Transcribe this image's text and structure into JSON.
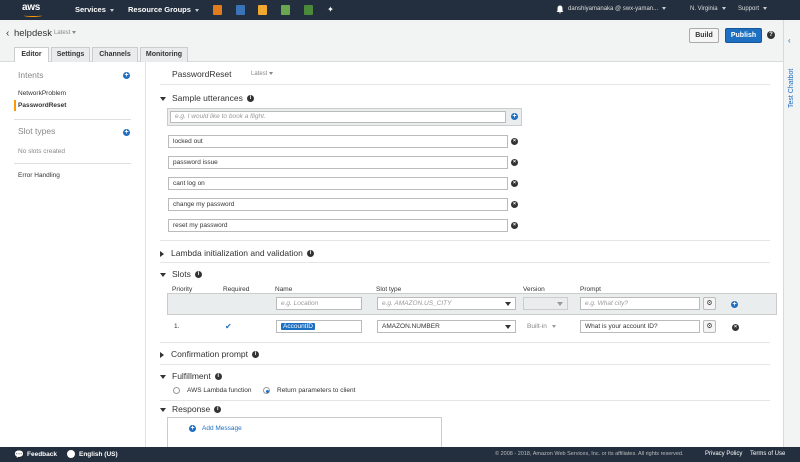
{
  "topnav": {
    "logo": "aws",
    "services": "Services",
    "resource_groups": "Resource Groups",
    "user": "danshiyamanaka @ swx-yaman...",
    "region": "N. Virginia",
    "support": "Support"
  },
  "header": {
    "app_name": "helpdesk",
    "app_version": "Latest",
    "tabs": [
      {
        "label": "Editor"
      },
      {
        "label": "Settings"
      },
      {
        "label": "Channels"
      },
      {
        "label": "Monitoring"
      }
    ],
    "build_label": "Build",
    "publish_label": "Publish",
    "help": "?"
  },
  "chatbot": {
    "label": "Test Chatbot",
    "chevron": "‹"
  },
  "sidebar": {
    "intents_heading": "Intents",
    "intents": [
      {
        "label": "NetworkProblem"
      },
      {
        "label": "PasswordReset"
      }
    ],
    "slot_types_heading": "Slot types",
    "no_slots": "No slots created",
    "error_handling": "Error Handling"
  },
  "intent": {
    "title": "PasswordReset",
    "version": "Latest"
  },
  "sections": {
    "sample_utterances": "Sample utterances",
    "lambda": "Lambda initialization and validation",
    "slots": "Slots",
    "confirmation": "Confirmation prompt",
    "fulfillment": "Fulfillment",
    "response": "Response"
  },
  "utterances": {
    "placeholder": "e.g. I would like to book a flight.",
    "items": [
      "locked out",
      "password issue",
      "cant log on",
      "change my password",
      "reset my password"
    ]
  },
  "slots": {
    "headers": {
      "priority": "Priority",
      "required": "Required",
      "name": "Name",
      "slot_type": "Slot type",
      "version": "Version",
      "prompt": "Prompt"
    },
    "new_row": {
      "name_placeholder": "e.g. Location",
      "type_placeholder": "e.g. AMAZON.US_CITY",
      "prompt_placeholder": "e.g. What city?"
    },
    "rows": [
      {
        "priority": "1.",
        "required": true,
        "name": "AccountID",
        "slot_type": "AMAZON.NUMBER",
        "version": "Built-in",
        "prompt": "What is your account ID?"
      }
    ]
  },
  "fulfillment": {
    "options": [
      {
        "label": "AWS Lambda function",
        "selected": false
      },
      {
        "label": "Return parameters to client",
        "selected": true
      }
    ]
  },
  "response": {
    "add_message": "Add Message"
  },
  "footer": {
    "feedback": "Feedback",
    "language": "English (US)",
    "copyright": "© 2008 - 2018, Amazon Web Services, Inc. or its affiliates. All rights reserved.",
    "privacy": "Privacy Policy",
    "terms": "Terms of Use"
  },
  "colors": {
    "nav_bg": "#232f3e",
    "accent": "#1d6fc1",
    "active_marker": "#ff9900"
  }
}
